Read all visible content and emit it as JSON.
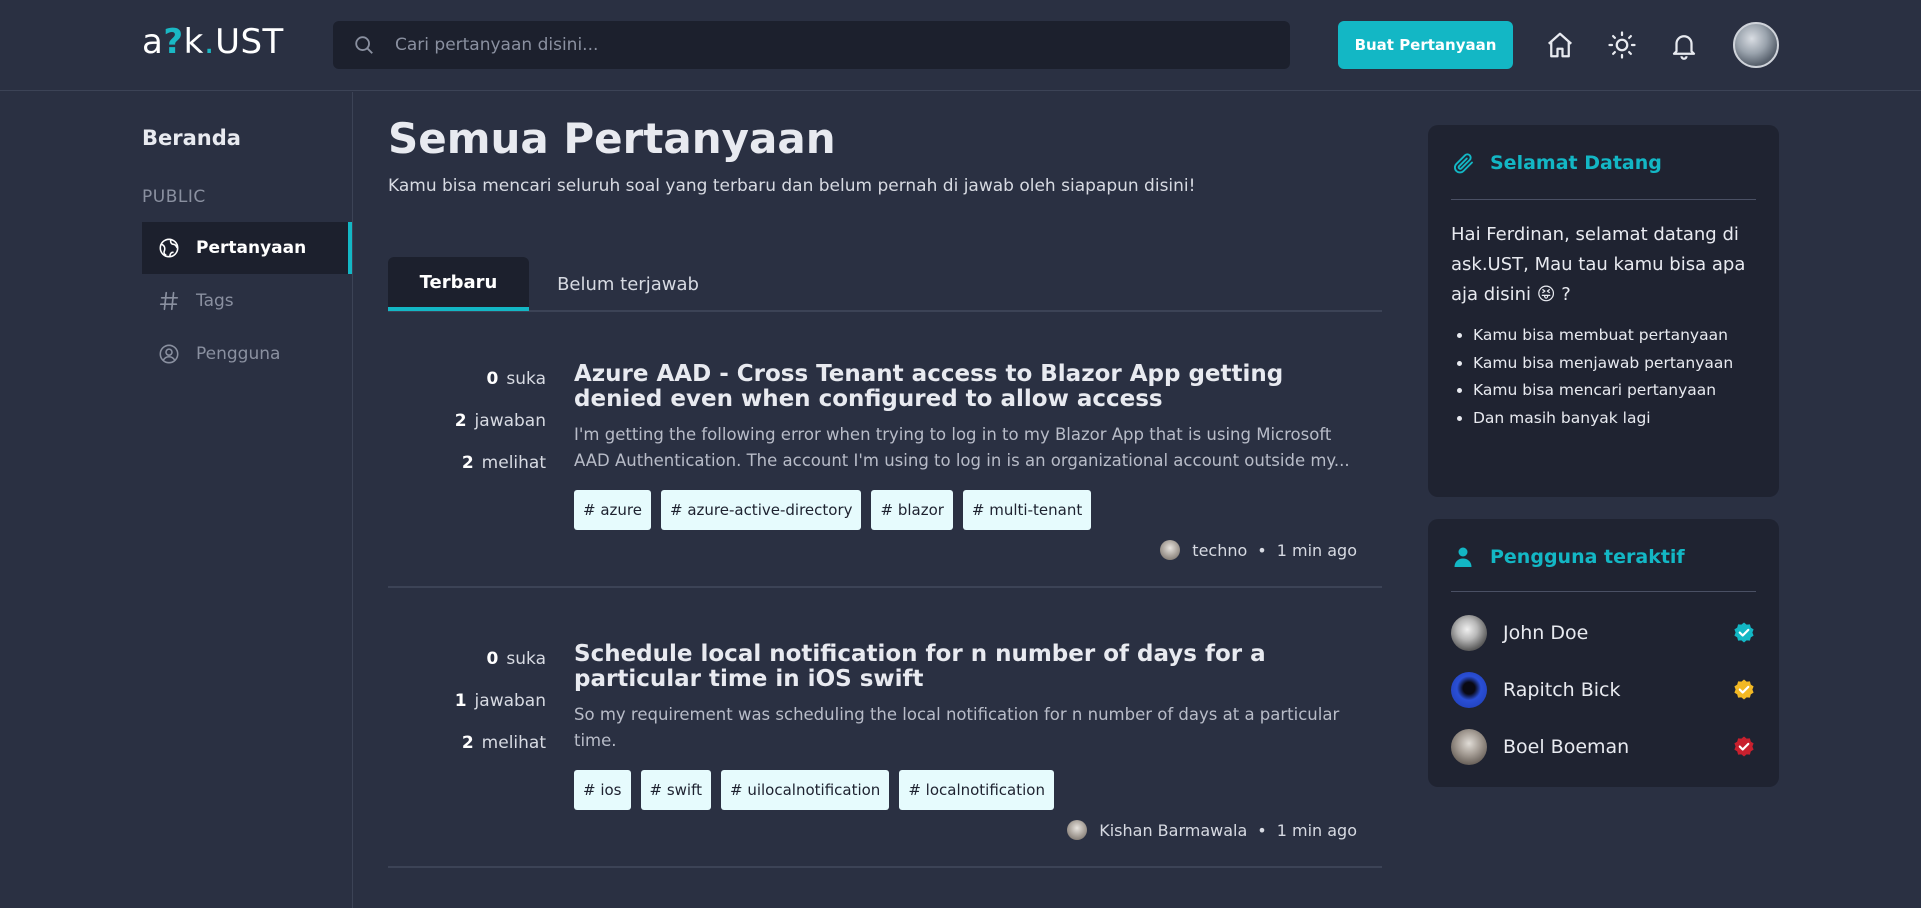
{
  "header": {
    "logo": {
      "prefix": "a",
      "q": "?",
      "middle": "k",
      "dot": ".",
      "suffix": "UST"
    },
    "search_placeholder": "Cari pertanyaan disini...",
    "ask_button": "Buat Pertanyaan",
    "icons": [
      "home-icon",
      "sun-icon",
      "bell-icon"
    ]
  },
  "sidebar": {
    "home": "Beranda",
    "section": "PUBLIC",
    "items": [
      {
        "label": "Pertanyaan",
        "icon": "globe-icon",
        "active": true
      },
      {
        "label": "Tags",
        "icon": "hash-icon",
        "active": false
      },
      {
        "label": "Pengguna",
        "icon": "user-circle-icon",
        "active": false
      }
    ]
  },
  "main": {
    "title": "Semua Pertanyaan",
    "subtitle": "Kamu bisa mencari seluruh soal yang terbaru dan belum pernah di jawab oleh siapapun disini!",
    "tabs": [
      {
        "label": "Terbaru",
        "active": true
      },
      {
        "label": "Belum terjawab",
        "active": false
      }
    ],
    "questions": [
      {
        "likes": "0",
        "likes_label": "suka",
        "answers": "2",
        "answers_label": "jawaban",
        "views": "2",
        "views_label": "melihat",
        "title": "Azure AAD - Cross Tenant access to Blazor App getting denied even when configured to allow access",
        "body": "I'm getting the following error when trying to log in to my Blazor App that is using Microsoft AAD Authentication. The account I'm using to log in is an organizational account outside my...",
        "tags": [
          "# azure",
          "# azure-active-directory",
          "# blazor",
          "# multi-tenant"
        ],
        "author": "techno",
        "separator": "•",
        "time": "1 min ago"
      },
      {
        "likes": "0",
        "likes_label": "suka",
        "answers": "1",
        "answers_label": "jawaban",
        "views": "2",
        "views_label": "melihat",
        "title": "Schedule local notification for n number of days for a particular time in iOS swift",
        "body": "So my requirement was scheduling the local notification for n number of days at a particular time.",
        "tags": [
          "# ios",
          "# swift",
          "# uilocalnotification",
          "# localnotification"
        ],
        "author": "Kishan Barmawala",
        "separator": "•",
        "time": "1 min ago"
      }
    ]
  },
  "welcome_card": {
    "title": "Selamat Datang",
    "text": "Hai Ferdinan, selamat datang di ask.UST, Mau tau kamu bisa apa aja disini 😝 ?",
    "items": [
      "Kamu bisa membuat pertanyaan",
      "Kamu bisa menjawab pertanyaan",
      "Kamu bisa mencari pertanyaan",
      "Dan masih banyak lagi"
    ]
  },
  "active_users_card": {
    "title": "Pengguna teraktif",
    "users": [
      {
        "name": "John Doe",
        "badge_color": "#13b7c5"
      },
      {
        "name": "Rapitch Bick",
        "badge_color": "#f2b824"
      },
      {
        "name": "Boel Boeman",
        "badge_color": "#c8202e"
      }
    ]
  },
  "colors": {
    "accent": "#13b7c5",
    "background": "#2a3042",
    "panel": "#1f2331",
    "tag_bg": "#e6fbfd"
  }
}
